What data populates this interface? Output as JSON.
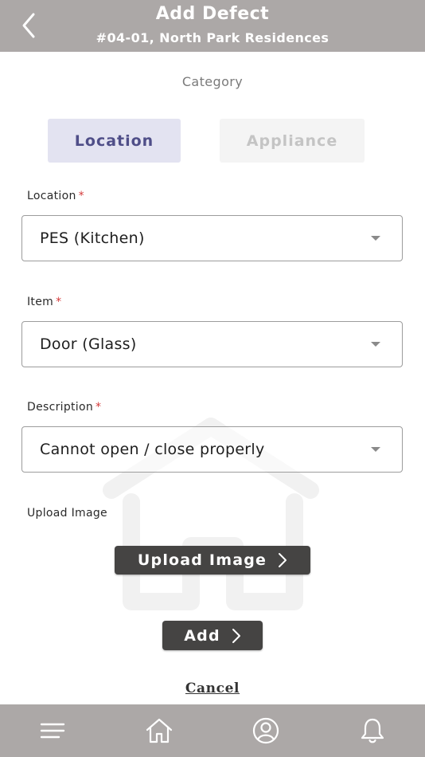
{
  "header": {
    "title": "Add Defect",
    "subtitle": "#04-01, North Park Residences",
    "back_icon": "chevron-left-icon"
  },
  "category": {
    "label": "Category",
    "tabs": [
      {
        "label": "Location",
        "selected": true
      },
      {
        "label": "Appliance",
        "selected": false
      }
    ]
  },
  "form": {
    "location": {
      "label": "Location",
      "required_mark": "*",
      "value": "PES (Kitchen)"
    },
    "item": {
      "label": "Item",
      "required_mark": "*",
      "value": "Door (Glass)"
    },
    "description": {
      "label": "Description",
      "required_mark": "*",
      "value": "Cannot open / close properly"
    },
    "upload": {
      "label": "Upload Image",
      "button_label": "Upload Image"
    }
  },
  "actions": {
    "add_label": "Add",
    "cancel_label": "Cancel"
  },
  "bottom_nav": {
    "items": [
      "menu-icon",
      "home-icon",
      "profile-icon",
      "bell-icon"
    ]
  },
  "colors": {
    "header_bg": "#aca8a7",
    "tab_selected_bg": "#e3e3f1",
    "tab_selected_text": "#4f4e88",
    "button_bg": "#454443",
    "required": "#d43a3a"
  }
}
